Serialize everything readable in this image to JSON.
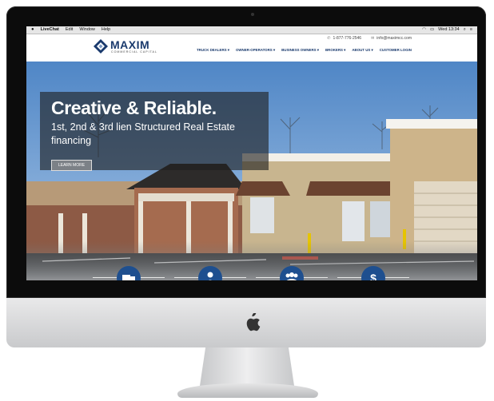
{
  "menubar": {
    "apple": "",
    "app": "LiveChat",
    "items": [
      "Edit",
      "Window",
      "Help"
    ],
    "clock": "Wed 13:34"
  },
  "site": {
    "logo_name": "MAXIM",
    "logo_tagline": "COMMERCIAL CAPITAL",
    "phone": "1-877-776-2546",
    "email": "info@maximcc.com",
    "nav": [
      "TRUCK DEALERS ▾",
      "OWNER-OPERATORS ▾",
      "BUSINESS OWNERS ▾",
      "BROKERS ▾",
      "ABOUT US ▾",
      "CUSTOMER LOGIN"
    ]
  },
  "hero": {
    "title": "Creative & Reliable.",
    "subtitle": "1st, 2nd & 3rd lien Structured Real Estate financing",
    "button": "LEARN MORE"
  },
  "features": [
    {
      "icon": "truck-icon",
      "glyph": "▬"
    },
    {
      "icon": "person-icon",
      "glyph": "●"
    },
    {
      "icon": "group-icon",
      "glyph": "●●"
    },
    {
      "icon": "dollar-icon",
      "glyph": "$"
    }
  ],
  "colors": {
    "brand_blue": "#1a3a6d",
    "feature_blue": "#1e4f8f"
  }
}
